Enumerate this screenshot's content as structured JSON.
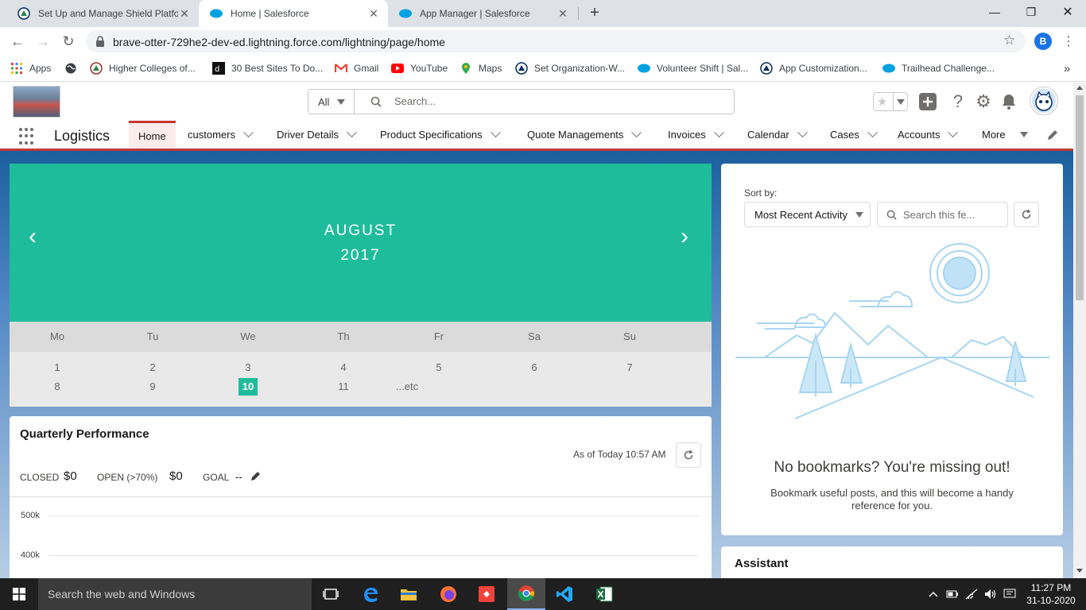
{
  "browser": {
    "tabs": [
      {
        "title": "Set Up and Manage Shield Platfo",
        "active": false
      },
      {
        "title": "Home | Salesforce",
        "active": true
      },
      {
        "title": "App Manager | Salesforce",
        "active": false
      }
    ],
    "new_tab_symbol": "+",
    "url": "brave-otter-729he2-dev-ed.lightning.force.com/lightning/page/home",
    "profile_initial": "B",
    "bookmarks": [
      {
        "label": "Apps",
        "icon": "apps-grid-icon"
      },
      {
        "label": "",
        "icon": "globe-icon"
      },
      {
        "label": "Higher Colleges of...",
        "icon": "college-icon"
      },
      {
        "label": "30 Best Sites To Do...",
        "icon": "site-icon"
      },
      {
        "label": "Gmail",
        "icon": "gmail-icon"
      },
      {
        "label": "YouTube",
        "icon": "youtube-icon"
      },
      {
        "label": "Maps",
        "icon": "maps-icon"
      },
      {
        "label": "Set Organization-W...",
        "icon": "trailhead-icon"
      },
      {
        "label": "Volunteer Shift | Sal...",
        "icon": "salesforce-cloud-icon"
      },
      {
        "label": "App Customization...",
        "icon": "trailhead-icon"
      },
      {
        "label": "Trailhead Challenge...",
        "icon": "salesforce-cloud-icon"
      }
    ],
    "more_bookmarks": "»"
  },
  "sf": {
    "search_scope": "All",
    "search_placeholder": "Search...",
    "app_name": "Logistics",
    "nav": [
      {
        "label": "Home",
        "active": true,
        "chevron": false
      },
      {
        "label": "customers",
        "chevron": true
      },
      {
        "label": "Driver Details",
        "chevron": true
      },
      {
        "label": "Product Specifications",
        "chevron": true
      },
      {
        "label": "Quote Managements",
        "chevron": true
      },
      {
        "label": "Invoices",
        "chevron": true
      },
      {
        "label": "Calendar",
        "chevron": true
      },
      {
        "label": "Cases",
        "chevron": true
      },
      {
        "label": "Accounts",
        "chevron": true
      },
      {
        "label": "More",
        "chevron": false
      }
    ]
  },
  "calendar": {
    "month": "AUGUST",
    "year": "2017",
    "prev": "‹",
    "next": "›",
    "weekdays": [
      "Mo",
      "Tu",
      "We",
      "Th",
      "Fr",
      "Sa",
      "Su"
    ],
    "row1": [
      "1",
      "2",
      "3",
      "4",
      "5",
      "6",
      "7"
    ],
    "row2": [
      "8",
      "9",
      "10",
      "11",
      "...etc"
    ],
    "today": "10",
    "accent": "#1fbc9c"
  },
  "quarterly": {
    "title": "Quarterly Performance",
    "as_of": "As of Today 10:57 AM",
    "closed_label": "CLOSED",
    "closed_value": "$0",
    "open_label": "OPEN (>70%)",
    "open_value": "$0",
    "goal_label": "GOAL",
    "goal_value": "--",
    "y_ticks": [
      "500k",
      "400k"
    ]
  },
  "feed": {
    "sort_label": "Sort by:",
    "sort_value": "Most Recent Activity",
    "search_placeholder": "Search this fe...",
    "empty_title": "No bookmarks? You're missing out!",
    "empty_text": "Bookmark useful posts, and this will become a handy reference for you."
  },
  "assistant": {
    "title": "Assistant"
  },
  "taskbar": {
    "search": "Search the web and Windows",
    "time": "11:27 PM",
    "date": "31-10-2020"
  }
}
